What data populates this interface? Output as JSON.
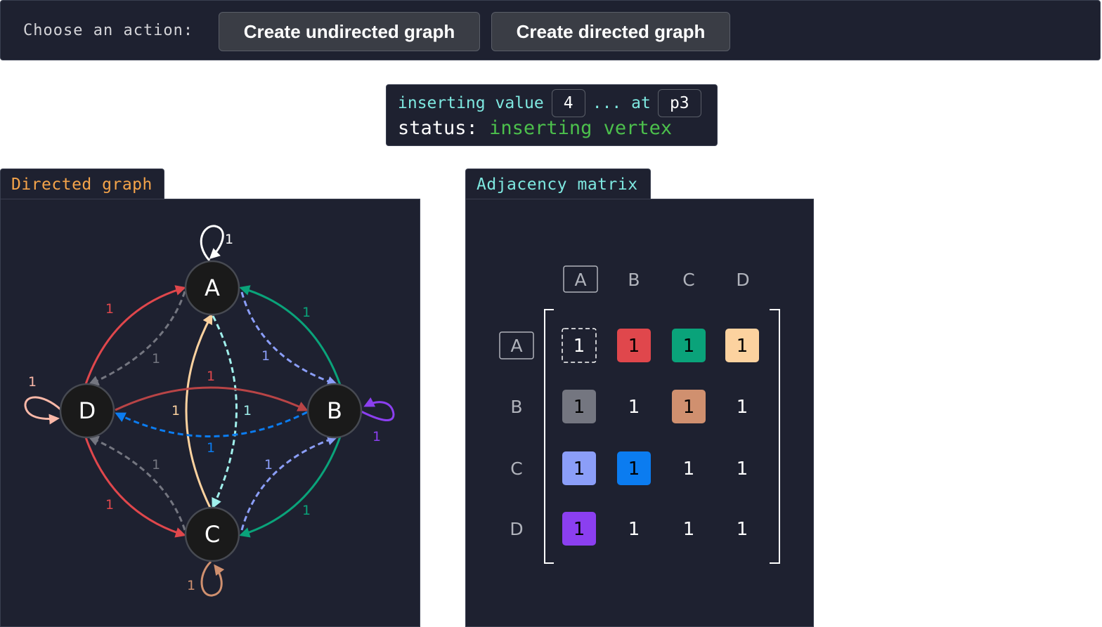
{
  "toolbar": {
    "prompt": "Choose an action:",
    "create_undirected_label": "Create undirected graph",
    "create_directed_label": "Create directed graph"
  },
  "status": {
    "inserting_label": "inserting value",
    "value": "4",
    "ellipsis_at": "... at",
    "position": "p3",
    "status_label": "status:",
    "status_value": "inserting vertex"
  },
  "graph": {
    "tab_title": "Directed graph",
    "nodes": [
      "A",
      "B",
      "C",
      "D"
    ],
    "edges": {
      "AA": "1",
      "DA": "1",
      "AD": "1",
      "CA": "1",
      "AC": "1",
      "BA": "1",
      "AB": "1",
      "DB": "1",
      "BD": "1",
      "DD": "1",
      "BB": "1",
      "DC": "1",
      "CD": "1",
      "CB": "1",
      "BC": "1",
      "CC": "1"
    }
  },
  "matrix": {
    "tab_title": "Adjacency matrix",
    "col_headers": [
      "A",
      "B",
      "C",
      "D"
    ],
    "row_headers": [
      "A",
      "B",
      "C",
      "D"
    ],
    "rows": [
      [
        "1",
        "1",
        "1",
        "1"
      ],
      [
        "1",
        "1",
        "1",
        "1"
      ],
      [
        "1",
        "1",
        "1",
        "1"
      ],
      [
        "1",
        "1",
        "1",
        "1"
      ]
    ],
    "colors": {
      "AB": "#e0474c",
      "AC": "#0aa37a",
      "AD": "#fcd29f",
      "BA": "#747680",
      "BC": "#d0906f",
      "CA": "#8b9ef8",
      "CB": "#0b7cf0",
      "DA": "#8b3ff0"
    }
  }
}
